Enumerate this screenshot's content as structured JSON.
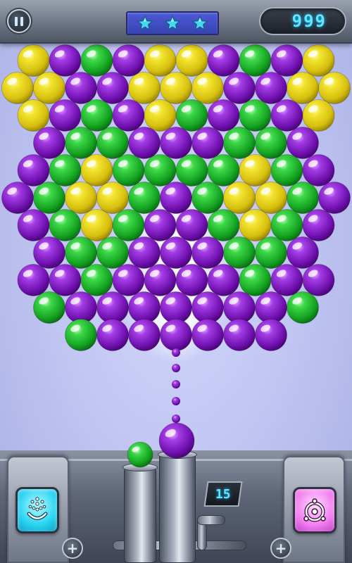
{
  "hud": {
    "score": "999",
    "stars_earned": 3,
    "stars_total": 3,
    "shots_remaining": "15"
  },
  "colors": {
    "purple": "#8a1fc9",
    "green": "#1bb32e",
    "yellow": "#e6d21a",
    "star": "#49d6f0",
    "cyan_text": "#5ee8ff"
  },
  "icons": {
    "pause": "pause-icon",
    "star": "star-icon",
    "left_booster": "fountain-smile-icon",
    "right_booster": "target-bomb-icon",
    "plus": "plus-icon"
  },
  "bubble_grid": {
    "rows": [
      [
        "yellow",
        "purple",
        "green",
        "purple",
        "yellow",
        "yellow",
        "purple",
        "green",
        "purple",
        "yellow"
      ],
      [
        "yellow",
        "yellow",
        "purple",
        "purple",
        "yellow",
        "yellow",
        "yellow",
        "purple",
        "purple",
        "yellow",
        "yellow"
      ],
      [
        "yellow",
        "purple",
        "green",
        "purple",
        "yellow",
        "green",
        "purple",
        "green",
        "purple",
        "yellow"
      ],
      [
        "purple",
        "green",
        "green",
        "purple",
        "purple",
        "purple",
        "green",
        "green",
        "purple"
      ],
      [
        "purple",
        "green",
        "yellow",
        "green",
        "green",
        "green",
        "green",
        "yellow",
        "green",
        "purple"
      ],
      [
        "purple",
        "green",
        "yellow",
        "yellow",
        "green",
        "purple",
        "green",
        "yellow",
        "yellow",
        "green",
        "purple"
      ],
      [
        "purple",
        "green",
        "yellow",
        "green",
        "purple",
        "purple",
        "green",
        "yellow",
        "green",
        "purple"
      ],
      [
        "purple",
        "green",
        "green",
        "purple",
        "purple",
        "purple",
        "green",
        "green",
        "purple"
      ],
      [
        "purple",
        "purple",
        "green",
        "purple",
        "purple",
        "purple",
        "purple",
        "green",
        "purple",
        "purple"
      ],
      [
        "green",
        "purple",
        "purple",
        "purple",
        "purple",
        "purple",
        "purple",
        "purple",
        "green"
      ],
      [
        "green",
        "purple",
        "purple",
        "purple",
        "purple",
        "purple",
        "purple"
      ]
    ]
  },
  "shooter": {
    "current_bubble": "purple",
    "next_bubble": "green"
  }
}
